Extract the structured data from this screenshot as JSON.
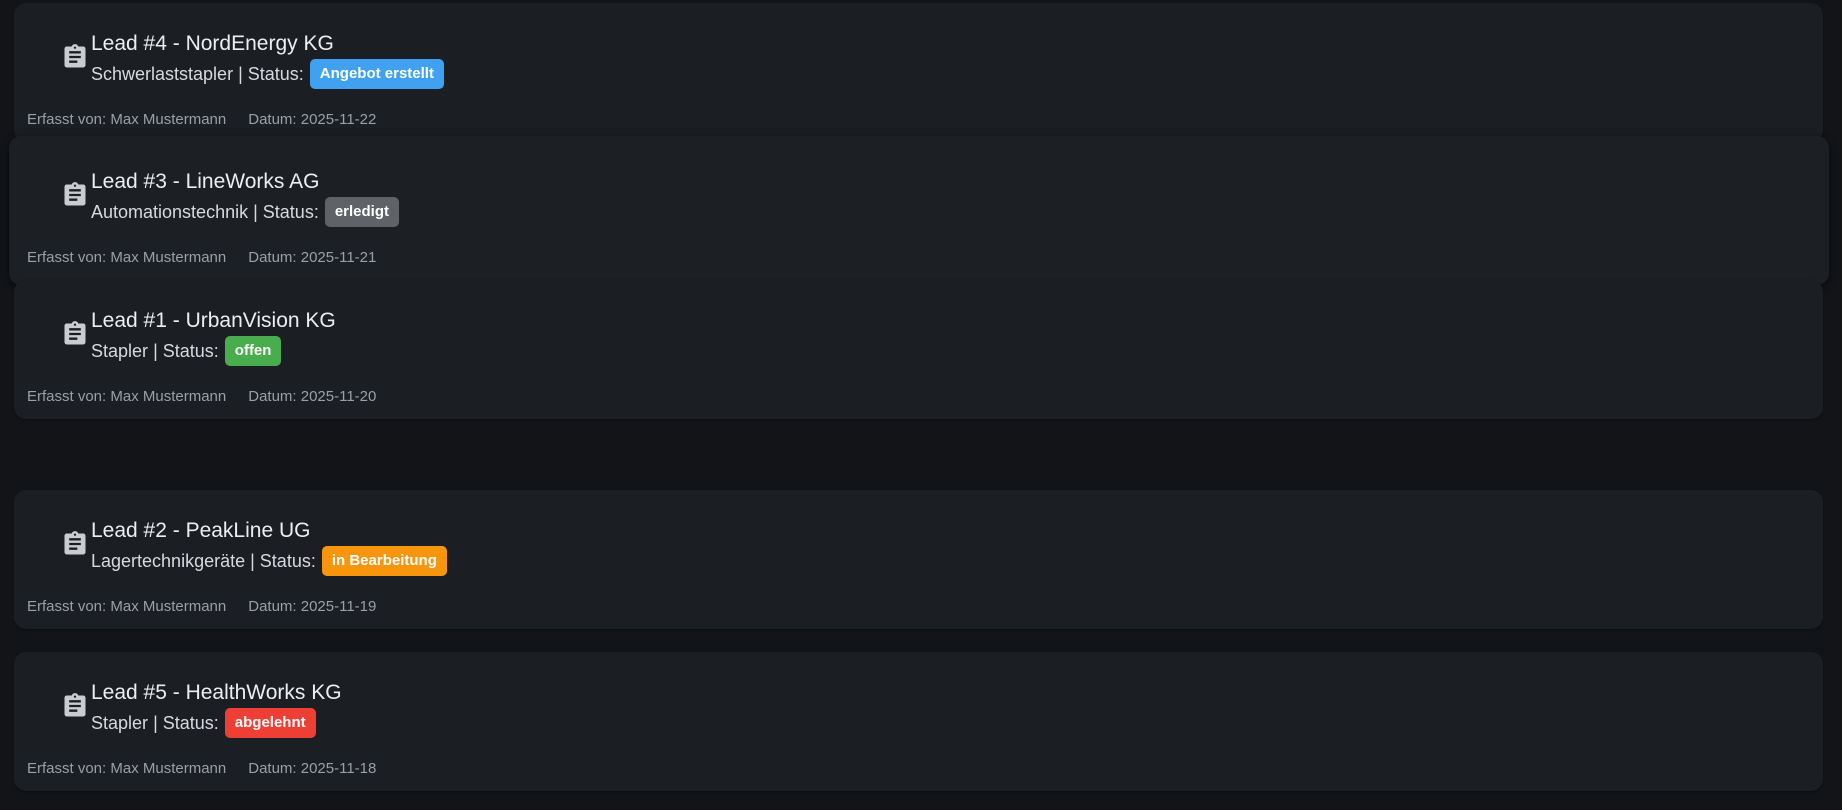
{
  "leads": [
    {
      "title": "Lead #4 - NordEnergy KG",
      "product": "Schwerlaststapler",
      "status_prefix": "| Status:",
      "status": "Angebot erstellt",
      "status_color": "#3fa1f0",
      "author": "Erfasst von: Max Mustermann",
      "date": "Datum: 2025-11-22",
      "icon": "clipboard-icon"
    },
    {
      "title": "Lead #3 - LineWorks AG",
      "product": "Automationstechnik",
      "status_prefix": "| Status:",
      "status": "erledigt",
      "status_color": "#5f6266",
      "author": "Erfasst von: Max Mustermann",
      "date": "Datum: 2025-11-21",
      "icon": "clipboard-icon"
    },
    {
      "title": "Lead #1 - UrbanVision KG",
      "product": "Stapler",
      "status_prefix": "| Status:",
      "status": "offen",
      "status_color": "#4aad4d",
      "author": "Erfasst von: Max Mustermann",
      "date": "Datum: 2025-11-20",
      "icon": "clipboard-icon"
    },
    {
      "title": "Lead #2 - PeakLine UG",
      "product": "Lagertechnikgeräte",
      "status_prefix": "| Status:",
      "status": "in Bearbeitung",
      "status_color": "#f7960d",
      "author": "Erfasst von: Max Mustermann",
      "date": "Datum: 2025-11-19",
      "icon": "clipboard-icon"
    },
    {
      "title": "Lead #5 - HealthWorks KG",
      "product": "Stapler",
      "status_prefix": "| Status:",
      "status": "abgelehnt",
      "status_color": "#ee3f34",
      "author": "Erfasst von: Max Mustermann",
      "date": "Datum: 2025-11-18",
      "icon": "clipboard-icon"
    }
  ],
  "colors": {
    "page_background": "#121418",
    "card_background": "#1b1e23"
  }
}
